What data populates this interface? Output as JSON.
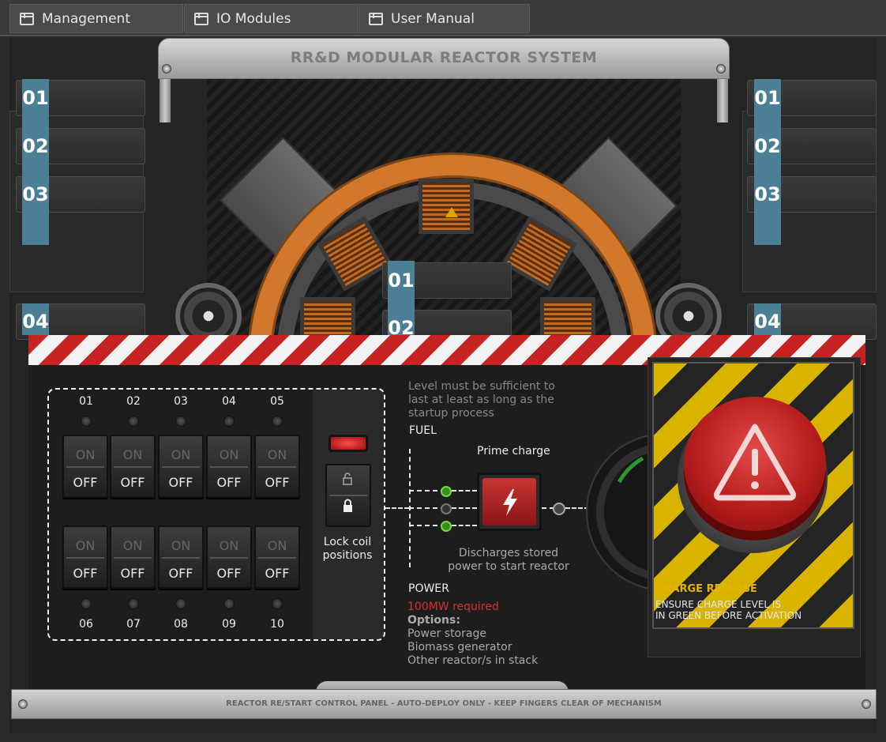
{
  "tabs": [
    {
      "label": "Management"
    },
    {
      "label": "IO Modules"
    },
    {
      "label": "User Manual"
    }
  ],
  "reactor": {
    "title": "RR&D MODULAR REACTOR SYSTEM"
  },
  "left_slots": [
    "01",
    "02",
    "03",
    "04"
  ],
  "right_slots": [
    "01",
    "02",
    "03",
    "04"
  ],
  "center_slots": [
    "01",
    "02"
  ],
  "switch_panel": {
    "top_numbers": [
      "01",
      "02",
      "03",
      "04",
      "05"
    ],
    "bottom_numbers": [
      "06",
      "07",
      "08",
      "09",
      "10"
    ],
    "on_label": "ON",
    "off_label": "OFF",
    "lock_label_line1": "Lock coil",
    "lock_label_line2": "positions"
  },
  "fuel": {
    "note_line1": "Level must be sufficient to",
    "note_line2": "last at least as long as the",
    "note_line3": "startup process",
    "label": "FUEL"
  },
  "prime": {
    "label": "Prime charge",
    "desc_line1": "Discharges stored",
    "desc_line2": "power to start reactor"
  },
  "power": {
    "label": "POWER",
    "required": "100MW required",
    "options_label": "Options:",
    "options": [
      "Power storage",
      "Biomass generator",
      "Other reactor/s in stack"
    ]
  },
  "charge_release": {
    "title": "CHARGE RELEASE",
    "line1": "ENSURE CHARGE LEVEL IS",
    "line2": "IN GREEN BEFORE ACTIVATION"
  },
  "footer": {
    "text": "REACTOR RE/START CONTROL PANEL - AUTO-DEPLOY ONLY - KEEP FINGERS CLEAR OF MECHANISM"
  },
  "colors": {
    "hazard_red": "#c72323",
    "hazard_yellow": "#d8b400",
    "slot_blue": "#4a7f96",
    "warning_red": "#d93030"
  }
}
